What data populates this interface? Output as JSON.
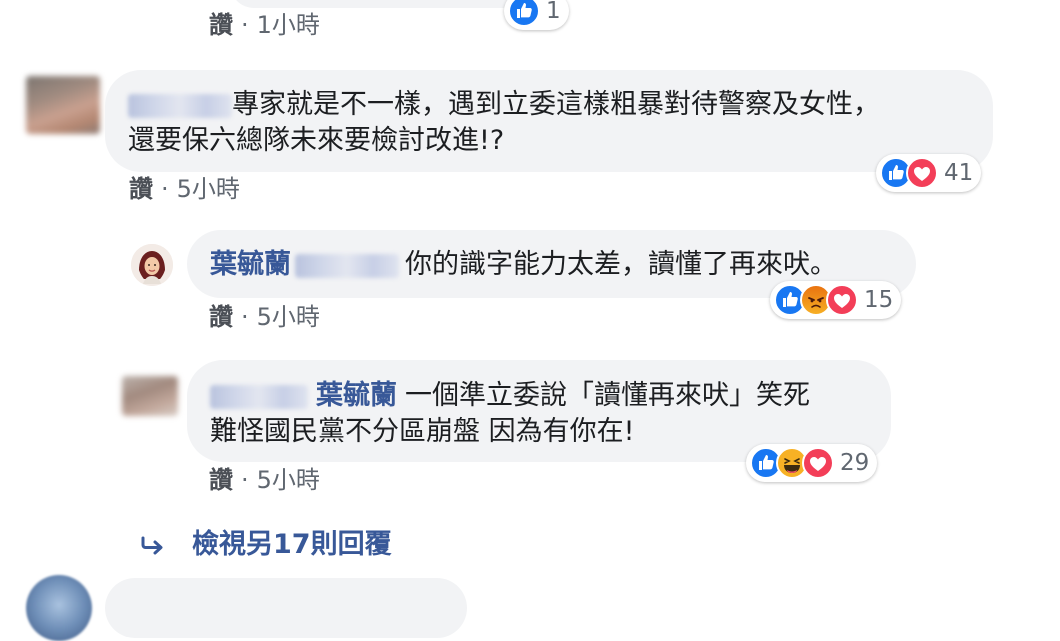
{
  "top_comment": {
    "like_label": "讚",
    "time": "1小時",
    "reaction_count": "1"
  },
  "comment1": {
    "line1": "專家就是不一樣，遇到立委這樣粗暴對待警察及女性，",
    "line2": "還要保六總隊未來要檢討改進!?",
    "like_label": "讚",
    "time": "5小時",
    "reaction_count": "41"
  },
  "reply1": {
    "author": "葉毓蘭",
    "text": "你的識字能力太差，讀懂了再來吠。",
    "like_label": "讚",
    "time": "5小時",
    "reaction_count": "15"
  },
  "reply2": {
    "mention": "葉毓蘭",
    "line1": "一個準立委說「讀懂再來吠」笑死",
    "line2": "難怪國民黨不分區崩盤 因為有你在!",
    "like_label": "讚",
    "time": "5小時",
    "reaction_count": "29"
  },
  "view_more": {
    "label": "檢視另17則回覆"
  },
  "colors": {
    "bubble_bg": "#f2f3f5",
    "link_blue": "#385898",
    "like_blue": "#1877f2",
    "love_red": "#f33e58",
    "angry_orange": "#e9710f",
    "haha_yellow": "#f7b125"
  },
  "icons": {
    "reply_arrow": "reply-arrow-icon",
    "like": "like-reaction-icon",
    "love": "love-reaction-icon",
    "angry": "angry-reaction-icon",
    "haha": "haha-reaction-icon"
  }
}
